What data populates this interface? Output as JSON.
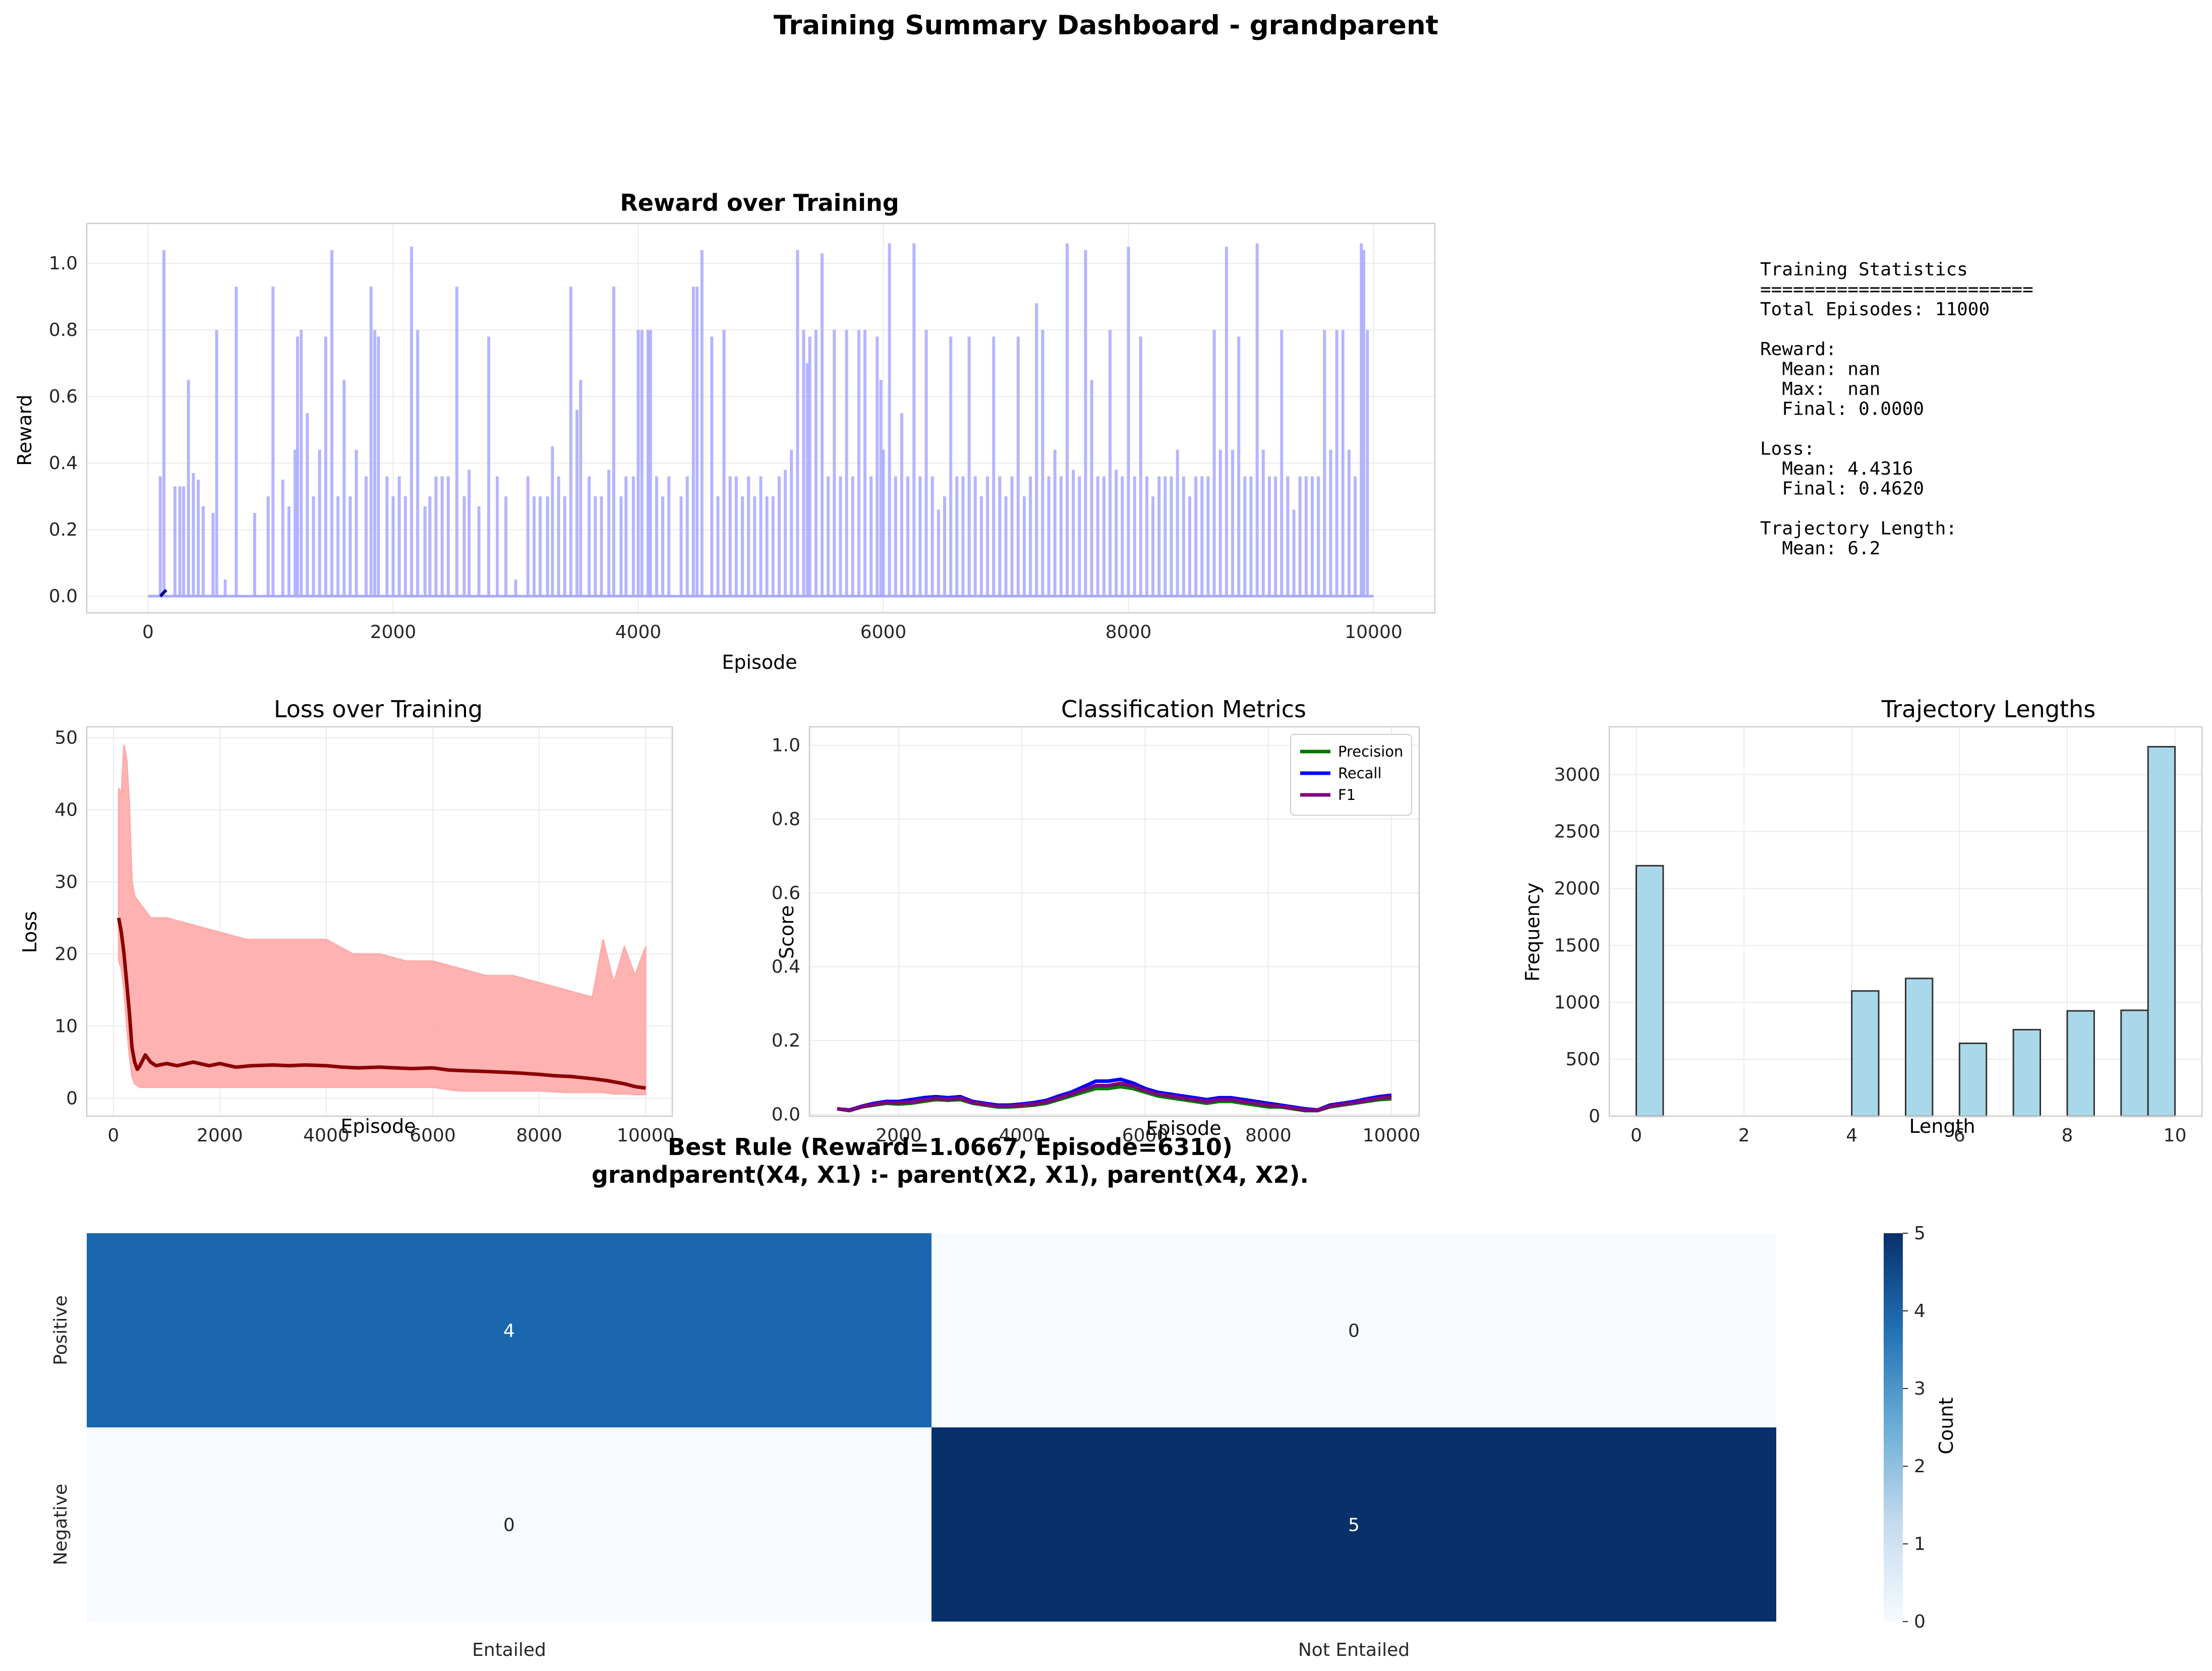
{
  "suptitle": "Training Summary Dashboard - grandparent",
  "colors": {
    "reward_line": "#a8a8ff",
    "reward_smooth": "#00008b",
    "loss_band": "#ffaaaa",
    "loss_smooth": "#8b0000",
    "precision": "#007700",
    "recall": "#0000ff",
    "f1": "#800080",
    "hist_fill": "#a9d8ea",
    "cm_high": "#08306b",
    "cm_mid": "#1a67ad",
    "cm_low": "#f7fbff"
  },
  "stats_panel": {
    "lines": [
      "Training Statistics",
      "=========================",
      "Total Episodes: 11000",
      "",
      "Reward:",
      "  Mean: nan",
      "  Max:  nan",
      "  Final: 0.0000",
      "",
      "Loss:",
      "  Mean: 4.4316",
      "  Final: 0.4620",
      "",
      "Trajectory Length:",
      "  Mean: 6.2"
    ]
  },
  "chart_data": [
    {
      "id": "reward",
      "type": "line",
      "title": "Reward over Training",
      "xlabel": "Episode",
      "ylabel": "Reward",
      "xlim": [
        -500,
        10500
      ],
      "ylim": [
        -0.05,
        1.12
      ],
      "xticks": [
        0,
        2000,
        4000,
        6000,
        8000,
        10000
      ],
      "yticks": [
        0.0,
        0.2,
        0.4,
        0.6,
        0.8,
        1.0
      ],
      "ytick_labels": [
        "0.0",
        "0.2",
        "0.4",
        "0.6",
        "0.8",
        "1.0"
      ],
      "grid": true,
      "raw_spikes": {
        "x": [
          100,
          130,
          220,
          260,
          290,
          330,
          370,
          410,
          450,
          530,
          560,
          630,
          720,
          870,
          980,
          1020,
          1100,
          1150,
          1200,
          1220,
          1250,
          1300,
          1350,
          1400,
          1450,
          1500,
          1550,
          1600,
          1650,
          1700,
          1780,
          1820,
          1850,
          1880,
          1950,
          2000,
          2050,
          2100,
          2150,
          2200,
          2260,
          2300,
          2350,
          2400,
          2450,
          2520,
          2580,
          2620,
          2700,
          2780,
          2850,
          2920,
          3000,
          3100,
          3150,
          3200,
          3260,
          3300,
          3350,
          3400,
          3450,
          3500,
          3530,
          3600,
          3650,
          3700,
          3760,
          3800,
          3860,
          3900,
          3960,
          4000,
          4030,
          4080,
          4100,
          4150,
          4200,
          4250,
          4350,
          4400,
          4450,
          4480,
          4520,
          4600,
          4650,
          4700,
          4750,
          4800,
          4850,
          4900,
          4950,
          5000,
          5050,
          5100,
          5150,
          5200,
          5250,
          5300,
          5350,
          5380,
          5400,
          5450,
          5500,
          5550,
          5600,
          5650,
          5700,
          5750,
          5800,
          5850,
          5900,
          5950,
          5980,
          6000,
          6050,
          6100,
          6150,
          6200,
          6250,
          6300,
          6350,
          6400,
          6450,
          6500,
          6550,
          6600,
          6650,
          6700,
          6750,
          6800,
          6850,
          6900,
          6950,
          7000,
          7050,
          7100,
          7150,
          7200,
          7250,
          7300,
          7350,
          7400,
          7450,
          7500,
          7550,
          7600,
          7650,
          7700,
          7750,
          7800,
          7850,
          7900,
          7950,
          8000,
          8050,
          8100,
          8150,
          8200,
          8250,
          8300,
          8350,
          8400,
          8450,
          8500,
          8550,
          8600,
          8650,
          8700,
          8750,
          8800,
          8850,
          8900,
          8950,
          9000,
          9050,
          9100,
          9150,
          9200,
          9250,
          9300,
          9350,
          9400,
          9450,
          9500,
          9550,
          9600,
          9650,
          9700,
          9750,
          9800,
          9850,
          9900,
          9920,
          9950
        ],
        "y": [
          0.36,
          1.04,
          0.33,
          0.33,
          0.33,
          0.65,
          0.37,
          0.35,
          0.27,
          0.25,
          0.8,
          0.05,
          0.93,
          0.25,
          0.3,
          0.93,
          0.35,
          0.27,
          0.44,
          0.78,
          0.8,
          0.55,
          0.3,
          0.44,
          0.78,
          1.04,
          0.3,
          0.65,
          0.3,
          0.44,
          0.36,
          0.93,
          0.8,
          0.78,
          0.36,
          0.3,
          0.36,
          0.3,
          1.05,
          0.8,
          0.27,
          0.3,
          0.36,
          0.36,
          0.36,
          0.93,
          0.3,
          0.38,
          0.27,
          0.78,
          0.36,
          0.3,
          0.05,
          0.36,
          0.3,
          0.3,
          0.3,
          0.45,
          0.36,
          0.3,
          0.93,
          0.56,
          0.65,
          0.36,
          0.3,
          0.3,
          0.38,
          0.93,
          0.3,
          0.36,
          0.36,
          0.8,
          0.8,
          0.8,
          0.8,
          0.36,
          0.3,
          0.36,
          0.3,
          0.36,
          0.93,
          0.93,
          1.04,
          0.78,
          0.3,
          0.8,
          0.36,
          0.36,
          0.3,
          0.36,
          0.3,
          0.36,
          0.3,
          0.3,
          0.36,
          0.38,
          0.44,
          1.04,
          0.8,
          0.7,
          0.78,
          0.8,
          1.03,
          0.36,
          0.8,
          0.36,
          0.8,
          0.36,
          0.8,
          0.8,
          0.36,
          0.78,
          0.65,
          0.44,
          1.06,
          0.36,
          0.55,
          0.36,
          1.06,
          0.36,
          0.8,
          0.36,
          0.26,
          0.3,
          0.78,
          0.36,
          0.36,
          0.78,
          0.36,
          0.3,
          0.36,
          0.78,
          0.36,
          0.3,
          0.36,
          0.78,
          0.3,
          0.36,
          0.88,
          0.8,
          0.36,
          0.44,
          0.36,
          1.06,
          0.38,
          0.36,
          1.04,
          0.65,
          0.36,
          0.36,
          0.8,
          0.38,
          0.36,
          1.05,
          0.36,
          0.78,
          0.36,
          0.3,
          0.36,
          0.36,
          0.36,
          0.44,
          0.36,
          0.3,
          0.36,
          0.36,
          0.36,
          0.8,
          0.44,
          1.05,
          0.44,
          0.78,
          0.36,
          0.36,
          1.06,
          0.44,
          0.36,
          0.36,
          0.8,
          0.36,
          0.26,
          0.36,
          0.36,
          0.36,
          0.36,
          0.8,
          0.44,
          0.8,
          0.8,
          0.44,
          0.36,
          1.06,
          1.04,
          0.8,
          0.44
        ]
      },
      "smoothed": {
        "x": [
          100,
          110,
          120,
          130,
          140,
          150
        ],
        "y": [
          0.0,
          0.003,
          0.008,
          0.012,
          0.015,
          0.018
        ]
      }
    },
    {
      "id": "loss",
      "type": "area",
      "title": "Loss over Training",
      "xlabel": "Episode",
      "ylabel": "Loss",
      "xlim": [
        -500,
        10500
      ],
      "ylim": [
        -2.5,
        51.5
      ],
      "xticks": [
        0,
        2000,
        4000,
        6000,
        8000,
        10000
      ],
      "yticks": [
        0,
        10,
        20,
        30,
        40,
        50
      ],
      "grid": true,
      "band": {
        "x": [
          100,
          150,
          200,
          250,
          300,
          350,
          400,
          500,
          700,
          1000,
          1500,
          2000,
          2500,
          3000,
          3500,
          4000,
          4500,
          5000,
          5500,
          6000,
          6500,
          7000,
          7500,
          8000,
          8500,
          9000,
          9200,
          9400,
          9600,
          9800,
          10000
        ],
        "upper": [
          43,
          42,
          49,
          47,
          41,
          30,
          28,
          27,
          25,
          25,
          24,
          23,
          22,
          22,
          22,
          22,
          20,
          20,
          19,
          19,
          18,
          17,
          17,
          16,
          15,
          14,
          22,
          16,
          21,
          17,
          21
        ],
        "lower": [
          19,
          18,
          15,
          10,
          6,
          3,
          2,
          1.5,
          1.5,
          1.5,
          1.5,
          1.5,
          1.5,
          1.5,
          1.5,
          1.5,
          1.5,
          1.5,
          1.5,
          1.5,
          1.0,
          1.0,
          1.0,
          1.0,
          0.8,
          0.8,
          0.8,
          0.6,
          0.6,
          0.5,
          0.5
        ]
      },
      "smoothed": {
        "x": [
          100,
          150,
          200,
          250,
          300,
          350,
          400,
          450,
          500,
          600,
          700,
          800,
          1000,
          1200,
          1500,
          1800,
          2000,
          2300,
          2600,
          3000,
          3300,
          3600,
          4000,
          4300,
          4600,
          5000,
          5300,
          5600,
          6000,
          6300,
          6600,
          7000,
          7300,
          7600,
          8000,
          8300,
          8600,
          9000,
          9300,
          9600,
          9800,
          10000
        ],
        "y": [
          25,
          23,
          20,
          16,
          12,
          7,
          5,
          4,
          4.5,
          6,
          5,
          4.5,
          4.8,
          4.5,
          5,
          4.5,
          4.8,
          4.3,
          4.5,
          4.6,
          4.5,
          4.6,
          4.5,
          4.3,
          4.2,
          4.3,
          4.2,
          4.1,
          4.2,
          3.9,
          3.8,
          3.7,
          3.6,
          3.5,
          3.3,
          3.1,
          3.0,
          2.7,
          2.4,
          2.0,
          1.6,
          1.4
        ]
      }
    },
    {
      "id": "metrics",
      "type": "line",
      "title": "Classification Metrics",
      "xlabel": "Episode",
      "ylabel": "Score",
      "xlim": [
        550,
        10450
      ],
      "ylim": [
        -0.005,
        1.05
      ],
      "xticks": [
        2000,
        4000,
        6000,
        8000,
        10000
      ],
      "yticks": [
        0.0,
        0.2,
        0.4,
        0.6,
        0.8,
        1.0
      ],
      "ytick_labels": [
        "0.0",
        "0.2",
        "0.4",
        "0.6",
        "0.8",
        "1.0"
      ],
      "grid": true,
      "legend_position": "top-right",
      "x": [
        1000,
        1200,
        1400,
        1600,
        1800,
        2000,
        2200,
        2400,
        2600,
        2800,
        3000,
        3200,
        3400,
        3600,
        3800,
        4000,
        4200,
        4400,
        4600,
        4800,
        5000,
        5200,
        5400,
        5600,
        5800,
        6000,
        6200,
        6400,
        6600,
        6800,
        7000,
        7200,
        7400,
        7600,
        7800,
        8000,
        8200,
        8400,
        8600,
        8800,
        9000,
        9200,
        9400,
        9600,
        9800,
        10000
      ],
      "series": [
        {
          "name": "Precision",
          "values": [
            0.015,
            0.01,
            0.02,
            0.025,
            0.03,
            0.028,
            0.03,
            0.035,
            0.04,
            0.038,
            0.04,
            0.03,
            0.025,
            0.02,
            0.02,
            0.022,
            0.025,
            0.03,
            0.04,
            0.05,
            0.06,
            0.07,
            0.07,
            0.075,
            0.07,
            0.06,
            0.05,
            0.045,
            0.04,
            0.035,
            0.03,
            0.035,
            0.035,
            0.03,
            0.025,
            0.02,
            0.02,
            0.015,
            0.01,
            0.01,
            0.02,
            0.025,
            0.03,
            0.035,
            0.04,
            0.042
          ]
        },
        {
          "name": "Recall",
          "values": [
            0.015,
            0.012,
            0.022,
            0.03,
            0.035,
            0.035,
            0.04,
            0.045,
            0.048,
            0.045,
            0.048,
            0.035,
            0.03,
            0.025,
            0.025,
            0.028,
            0.032,
            0.038,
            0.05,
            0.06,
            0.075,
            0.09,
            0.09,
            0.095,
            0.085,
            0.07,
            0.06,
            0.055,
            0.05,
            0.045,
            0.04,
            0.045,
            0.045,
            0.04,
            0.035,
            0.03,
            0.025,
            0.02,
            0.015,
            0.012,
            0.025,
            0.03,
            0.035,
            0.042,
            0.048,
            0.052
          ]
        },
        {
          "name": "F1",
          "values": [
            0.015,
            0.011,
            0.021,
            0.027,
            0.032,
            0.031,
            0.034,
            0.039,
            0.044,
            0.041,
            0.044,
            0.032,
            0.027,
            0.022,
            0.022,
            0.025,
            0.028,
            0.034,
            0.044,
            0.055,
            0.067,
            0.078,
            0.078,
            0.084,
            0.077,
            0.065,
            0.055,
            0.05,
            0.045,
            0.04,
            0.035,
            0.04,
            0.04,
            0.035,
            0.03,
            0.025,
            0.022,
            0.017,
            0.012,
            0.011,
            0.022,
            0.027,
            0.032,
            0.038,
            0.044,
            0.047
          ]
        }
      ]
    },
    {
      "id": "traj",
      "type": "bar",
      "title": "Trajectory Lengths",
      "xlabel": "Length",
      "ylabel": "Frequency",
      "xlim": [
        -0.5,
        10.5
      ],
      "ylim": [
        0,
        3420
      ],
      "xticks": [
        0,
        2,
        4,
        6,
        8,
        10
      ],
      "yticks": [
        0,
        500,
        1000,
        1500,
        2000,
        2500,
        3000
      ],
      "grid": true,
      "bin_width": 0.5,
      "bins": [
        0,
        0.5,
        1,
        1.5,
        2,
        2.5,
        3,
        3.5,
        4,
        4.5,
        5,
        5.5,
        6,
        6.5,
        7,
        7.5,
        8,
        8.5,
        9,
        9.5
      ],
      "values": [
        2200,
        0,
        0,
        0,
        0,
        0,
        0,
        0,
        1100,
        0,
        1210,
        0,
        640,
        0,
        760,
        0,
        925,
        0,
        930,
        3245
      ]
    },
    {
      "id": "confusion",
      "type": "heatmap",
      "title": "Best Rule (Reward=1.0667, Episode=6310)",
      "subtitle": "grandparent(X4, X1) :- parent(X2, X1), parent(X4, X2).",
      "row_labels": [
        "Positive",
        "Negative"
      ],
      "col_labels": [
        "Entailed",
        "Not Entailed"
      ],
      "values": [
        [
          4,
          0
        ],
        [
          0,
          5
        ]
      ],
      "colorbar_label": "Count",
      "colorbar_range": [
        0,
        5
      ],
      "colorbar_ticks": [
        0,
        1,
        2,
        3,
        4,
        5
      ]
    }
  ]
}
